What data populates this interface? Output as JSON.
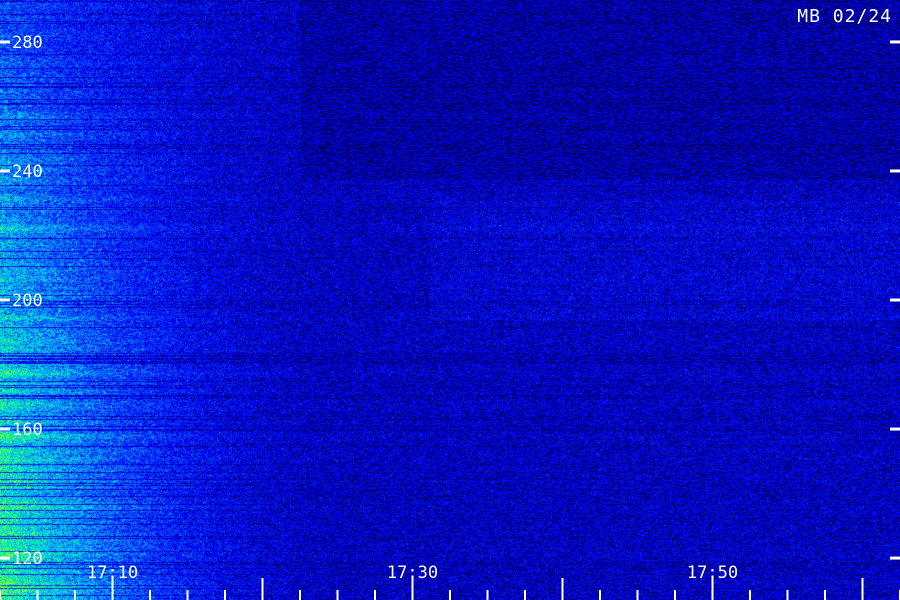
{
  "station_label": "MB 02/24",
  "chart_data": {
    "type": "heatmap",
    "title": "",
    "xlabel": "",
    "ylabel": "",
    "y_ticks": [
      {
        "value": 280,
        "label": "280"
      },
      {
        "value": 240,
        "label": "240"
      },
      {
        "value": 200,
        "label": "200"
      },
      {
        "value": 160,
        "label": "160"
      },
      {
        "value": 120,
        "label": "120"
      }
    ],
    "x_ticks": [
      {
        "label": "17:10",
        "minutes": 10
      },
      {
        "label": "17:30",
        "minutes": 30
      },
      {
        "label": "17:50",
        "minutes": 50
      }
    ],
    "ylim": [
      107,
      293
    ],
    "xlim_minutes": [
      2.5,
      62.5
    ],
    "minor_x_tick_step_minutes": 2.5,
    "colormap": [
      "#000010",
      "#00008c",
      "#0000ff",
      "#0050ff",
      "#00c8ff",
      "#00ff96",
      "#b4ff00"
    ],
    "bursts": [
      {
        "t_start_minutes": 2.5,
        "t_end_minutes": 22,
        "freq_low": 107,
        "freq_high": 293,
        "peak_level": 0.95
      }
    ]
  }
}
